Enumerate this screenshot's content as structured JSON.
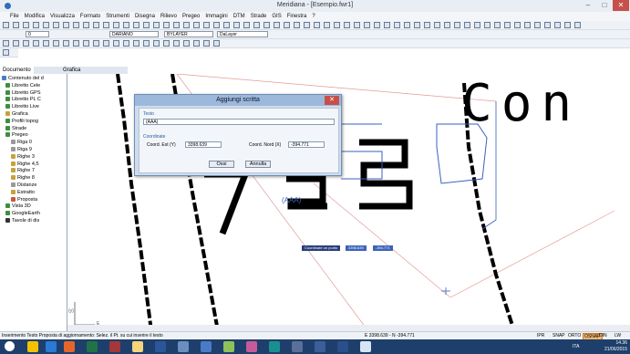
{
  "window": {
    "title": "Meridiana - [Esempio.fwr1]",
    "minimize": "–",
    "maximize": "□",
    "close": "✕"
  },
  "menu": [
    "File",
    "Modifica",
    "Visualizza",
    "Formato",
    "Strumenti",
    "Disegna",
    "Rilievo",
    "Pregeo",
    "Immagini",
    "DTM",
    "Strade",
    "GIS",
    "Finestra",
    "?"
  ],
  "toolbar": {
    "layer": "0",
    "color": "DARIANO",
    "linetype": "BYLAYER",
    "lineweight": "DaLayer"
  },
  "panel": {
    "tabs": [
      "Documento",
      "Grafica"
    ],
    "tree": [
      {
        "label": "Contenuto del d",
        "color": "#4a7bc8"
      },
      {
        "label": "Libretto Cele",
        "color": "#3c8f3c"
      },
      {
        "label": "Libretto GPS",
        "color": "#3c8f3c"
      },
      {
        "label": "Libretto PL C",
        "color": "#3c8f3c"
      },
      {
        "label": "Libretto Live",
        "color": "#3c8f3c"
      },
      {
        "label": "Grafica",
        "color": "#c7a23a"
      },
      {
        "label": "Profili topog",
        "color": "#3c8f3c"
      },
      {
        "label": "Strade",
        "color": "#3c8f3c"
      },
      {
        "label": "Pregeo",
        "color": "#3c8f3c"
      },
      {
        "label": "Riga 0",
        "color": "#999999"
      },
      {
        "label": "Riga 9",
        "color": "#999999"
      },
      {
        "label": "Righe 3",
        "color": "#c7a23a"
      },
      {
        "label": "Righe 4,5",
        "color": "#c7a23a"
      },
      {
        "label": "Righe 7",
        "color": "#c7a23a"
      },
      {
        "label": "Righe 8",
        "color": "#c7a23a"
      },
      {
        "label": "Distanze",
        "color": "#999999"
      },
      {
        "label": "Estratto",
        "color": "#c7a23a"
      },
      {
        "label": "Proposta",
        "color": "#c75a3a"
      },
      {
        "label": "Vista 3D",
        "color": "#3c8f3c"
      },
      {
        "label": "GoogleEarth",
        "color": "#3c8f3c"
      },
      {
        "label": "Tavole di dis",
        "color": "#333333"
      }
    ]
  },
  "dialog": {
    "title": "Aggiungi scritta",
    "close": "✕",
    "text_group": "Testo",
    "text_value": "(AAA)",
    "coord_group": "Coordinate",
    "east_label": "Coord. Est (Y)",
    "east_value": "3398.639",
    "north_label": "Coord. Nord (X)",
    "north_value": "-394.771",
    "ok": "Ossi",
    "cancel": "Annulla"
  },
  "canvas": {
    "big_text": "Con",
    "small_text": "(AAA)",
    "hint_label": "Coordinate un punto",
    "hint_x": "3398.639",
    "hint_y": "-394.771",
    "axis_y": "(y)",
    "axis_x": "E"
  },
  "status": {
    "message": "Inserimento Testo Proposta di aggiornamento: Selez. il Pt. su cui inserire il testo",
    "coords": "E  3398.639 - N  -394.771",
    "toggles": [
      "IPR",
      "SNAP",
      "ORTO",
      "OSNAP",
      "DIN",
      "LW"
    ],
    "active_toggle": "OSNAP"
  },
  "taskbar": {
    "lang": "ITA",
    "time": "14.36",
    "date": "21/06/2015"
  }
}
